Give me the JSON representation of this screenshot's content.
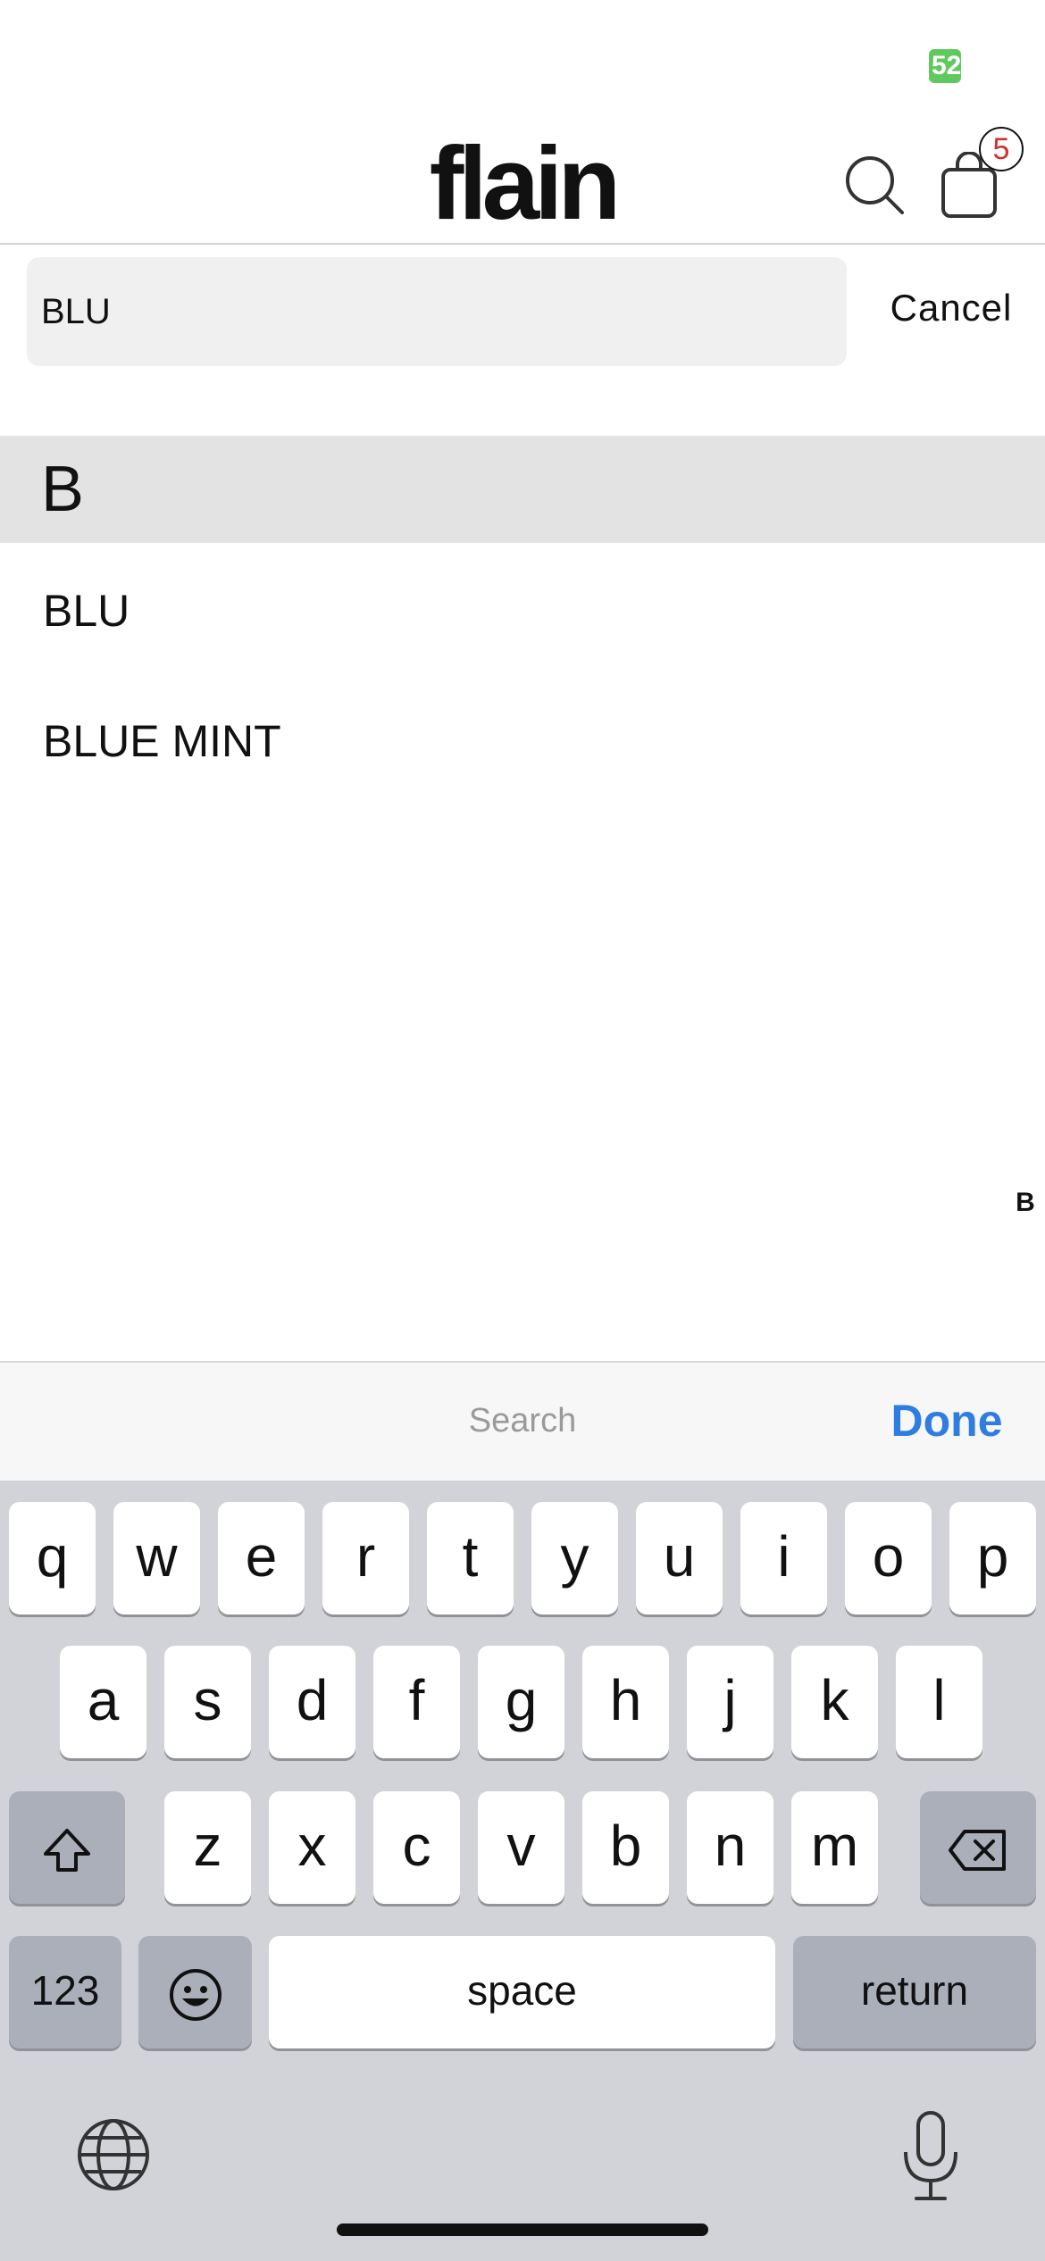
{
  "status_bar": {
    "battery_badge": "52"
  },
  "header": {
    "logo": "flain",
    "cart_count": "5"
  },
  "search": {
    "value": "BLU",
    "cancel_label": "Cancel"
  },
  "list": {
    "section": "B",
    "items": [
      "BLU",
      "BLUE MINT"
    ],
    "index_letter": "B"
  },
  "accessory": {
    "placeholder": "Search",
    "done_label": "Done"
  },
  "keyboard": {
    "row1": [
      "q",
      "w",
      "e",
      "r",
      "t",
      "y",
      "u",
      "i",
      "o",
      "p"
    ],
    "row2": [
      "a",
      "s",
      "d",
      "f",
      "g",
      "h",
      "j",
      "k",
      "l"
    ],
    "row3": [
      "z",
      "x",
      "c",
      "v",
      "b",
      "n",
      "m"
    ],
    "numbers_label": "123",
    "space_label": "space",
    "return_label": "return"
  },
  "colors": {
    "accent": "#2f7de1",
    "badge_text": "#d0312d",
    "status_green": "#5fc95f"
  }
}
